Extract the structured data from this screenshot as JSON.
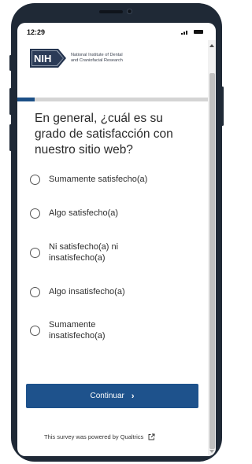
{
  "status_bar": {
    "time": "12:29"
  },
  "header": {
    "logo_text": "NIH",
    "org_line1": "National Institute of Dental",
    "org_line2": "and Craniofacial Research"
  },
  "progress": {
    "fraction": 0.09
  },
  "question": {
    "text": "En general, ¿cuál es su grado de satisfacción con nuestro sitio web?"
  },
  "options": [
    {
      "label": "Sumamente satisfecho(a)"
    },
    {
      "label": "Algo satisfecho(a)"
    },
    {
      "label": "Ni satisfecho(a) ni insatisfecho(a)"
    },
    {
      "label": "Algo insatisfecho(a)"
    },
    {
      "label": "Sumamente insatisfecho(a)"
    }
  ],
  "actions": {
    "continue_label": "Continuar"
  },
  "footer": {
    "powered_by": "This survey was powered by Qualtrics"
  },
  "colors": {
    "accent": "#1e528c",
    "progress_track": "#d4d4d4",
    "frame": "#1f2936"
  }
}
